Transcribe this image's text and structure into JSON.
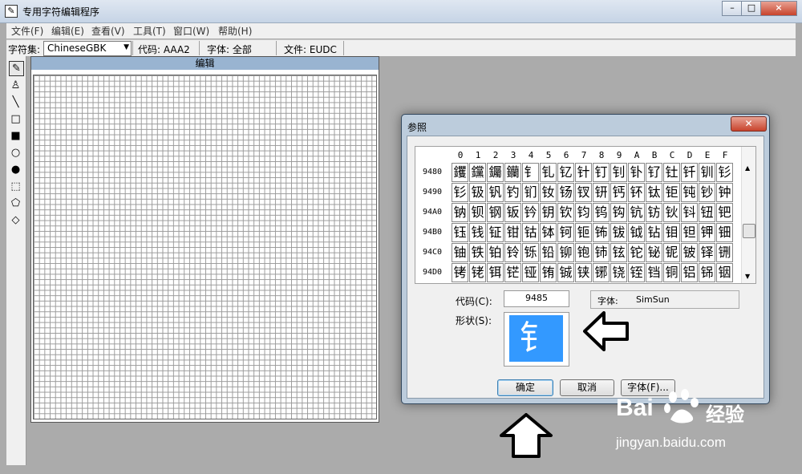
{
  "window": {
    "title": "专用字符编辑程序",
    "app_icon": "pencil-icon",
    "minimize": "–",
    "maximize": "□",
    "close": "×"
  },
  "menu": [
    {
      "label": "文件(F)"
    },
    {
      "label": "编辑(E)"
    },
    {
      "label": "查看(V)"
    },
    {
      "label": "工具(T)"
    },
    {
      "label": "窗口(W)"
    },
    {
      "label": "帮助(H)"
    }
  ],
  "toolbar": {
    "charset_label": "字符集:",
    "charset_value": "ChineseGBK",
    "code_text": "代码: AAA2",
    "font_text": "字体: 全部",
    "file_text": "文件: EUDC"
  },
  "tools": [
    "pencil-icon",
    "brush-icon",
    "line-icon",
    "rectangle-outline-icon",
    "rectangle-filled-icon",
    "ellipse-outline-icon",
    "ellipse-filled-icon",
    "rect-select-icon",
    "freeform-select-icon",
    "eraser-icon"
  ],
  "tool_glyphs": [
    "✎",
    "♙",
    "╲",
    "□",
    "■",
    "○",
    "●",
    "⬚",
    "⬠",
    "◇"
  ],
  "editor": {
    "caption": "编辑"
  },
  "dialog": {
    "title": "参照",
    "close": "✕",
    "columns": [
      "0",
      "1",
      "2",
      "3",
      "4",
      "5",
      "6",
      "7",
      "8",
      "9",
      "A",
      "B",
      "C",
      "D",
      "E",
      "F"
    ],
    "rows": [
      {
        "code": "9480",
        "chars": [
          "钁",
          "钂",
          "钃",
          "钄",
          "钅",
          "钆",
          "钇",
          "针",
          "钉",
          "钊",
          "钋",
          "钌",
          "钍",
          "钎",
          "钏",
          "钐"
        ]
      },
      {
        "code": "9490",
        "chars": [
          "钐",
          "钑",
          "钒",
          "钓",
          "钔",
          "钕",
          "钖",
          "钗",
          "钘",
          "钙",
          "钚",
          "钛",
          "钜",
          "钝",
          "钞",
          "钟"
        ]
      },
      {
        "code": "94A0",
        "chars": [
          "钠",
          "钡",
          "钢",
          "钣",
          "钤",
          "钥",
          "钦",
          "钧",
          "钨",
          "钩",
          "钪",
          "钫",
          "钬",
          "钭",
          "钮",
          "钯"
        ]
      },
      {
        "code": "94B0",
        "chars": [
          "钰",
          "钱",
          "钲",
          "钳",
          "钴",
          "钵",
          "钶",
          "钷",
          "钸",
          "钹",
          "钺",
          "钻",
          "钼",
          "钽",
          "钾",
          "钿"
        ]
      },
      {
        "code": "94C0",
        "chars": [
          "铀",
          "铁",
          "铂",
          "铃",
          "铄",
          "铅",
          "铆",
          "铇",
          "铈",
          "铉",
          "铊",
          "铋",
          "铌",
          "铍",
          "铎",
          "铏"
        ]
      },
      {
        "code": "94D0",
        "chars": [
          "铐",
          "铑",
          "铒",
          "铓",
          "铔",
          "铕",
          "铖",
          "铗",
          "铘",
          "铙",
          "铚",
          "铛",
          "铜",
          "铝",
          "铞",
          "铟"
        ]
      }
    ],
    "code_label": "代码(C):",
    "code_value": "9485",
    "font_label": "字体:",
    "font_value": "SimSun",
    "shape_label": "形状(S):",
    "shape_char": "钅",
    "buttons": {
      "ok": "确定",
      "cancel": "取消",
      "font": "字体(F)..."
    }
  },
  "watermark": {
    "brand_a": "Bai",
    "brand_b": "经验",
    "url": "jingyan.baidu.com"
  }
}
